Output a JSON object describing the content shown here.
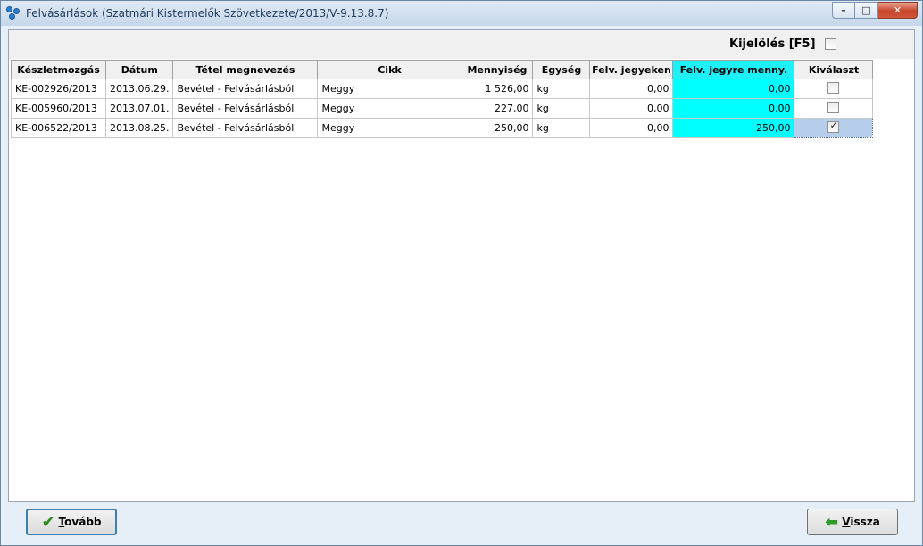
{
  "window": {
    "title": "Felvásárlások (Szatmári Kistermelők Szövetkezete/2013/V-9.13.8.7)",
    "controls": {
      "minimize": "–",
      "maximize": "□",
      "close": "✕"
    }
  },
  "toolbar": {
    "select_label": "Kijelölés [F5]",
    "select_checked": false
  },
  "grid": {
    "columns": [
      "Készletmozgás",
      "Dátum",
      "Tétel megnevezés",
      "Cikk",
      "Mennyiség",
      "Egység",
      "Felv. jegyeken",
      "Felv. jegyre menny.",
      "Kiválaszt"
    ],
    "highlight_color": "#00ffff",
    "rows": [
      {
        "movement": "KE-002926/2013",
        "date": "2013.06.29.",
        "item": "Bevétel - Felvásárlásból",
        "article": "Meggy",
        "quantity": "1 526,00",
        "unit": "kg",
        "on_notes": "0,00",
        "to_note": "0,00",
        "selected": false
      },
      {
        "movement": "KE-005960/2013",
        "date": "2013.07.01.",
        "item": "Bevétel - Felvásárlásból",
        "article": "Meggy",
        "quantity": "227,00",
        "unit": "kg",
        "on_notes": "0,00",
        "to_note": "0,00",
        "selected": false
      },
      {
        "movement": "KE-006522/2013",
        "date": "2013.08.25.",
        "item": "Bevétel - Felvásárlásból",
        "article": "Meggy",
        "quantity": "250,00",
        "unit": "kg",
        "on_notes": "0,00",
        "to_note": "250,00",
        "selected": true
      }
    ]
  },
  "footer": {
    "next_first": "T",
    "next_rest": "ovább",
    "next_icon": "checkmark-icon",
    "back_first": "V",
    "back_rest": "issza",
    "back_icon": "back-arrow-icon"
  }
}
